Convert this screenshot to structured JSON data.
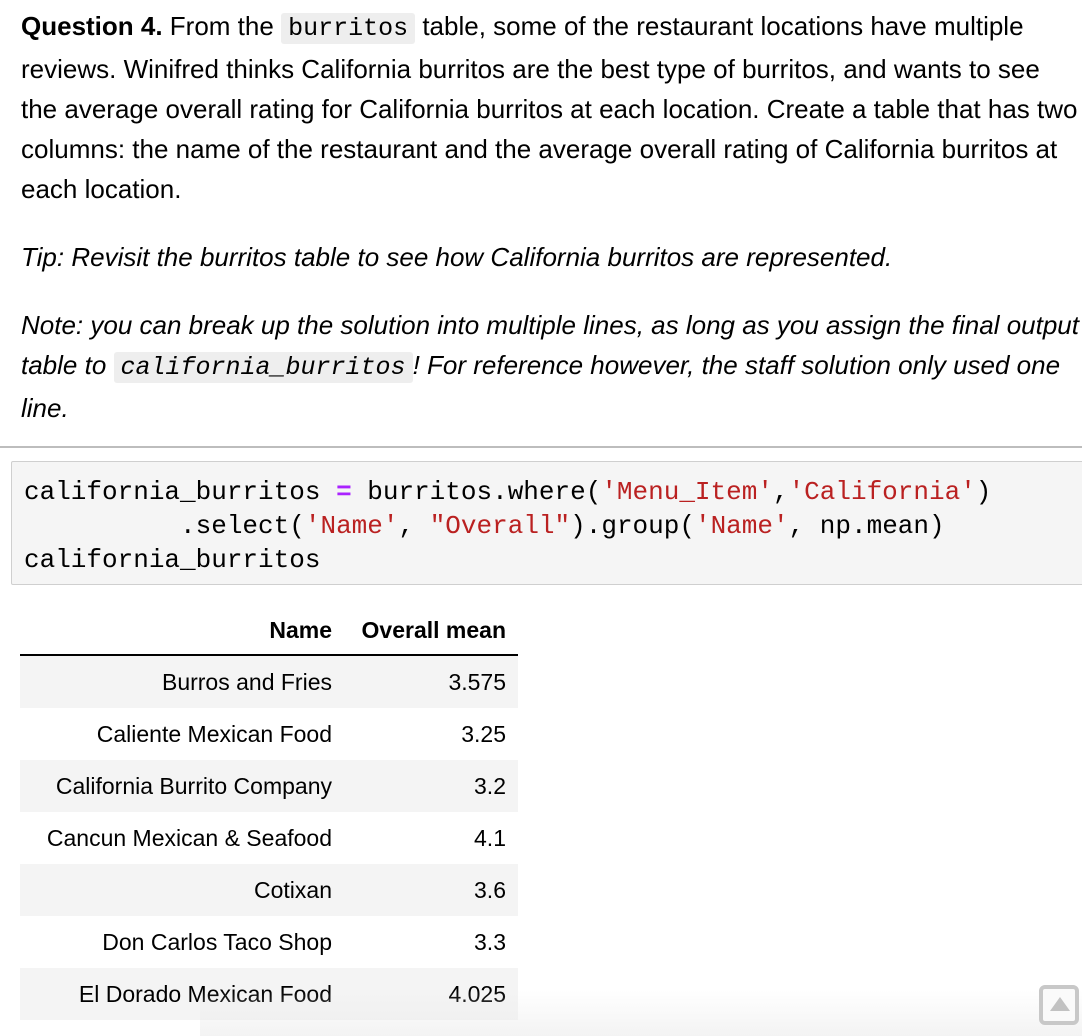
{
  "markdown": {
    "question_label": "Question 4.",
    "q_part1": " From the ",
    "q_code": "burritos",
    "q_part2": " table, some of the restaurant locations have multiple reviews. Winifred thinks California burritos are the best type of burritos, and wants to see the average overall rating for California burritos at each location. Create a table that has two columns: the name of the restaurant and the average overall rating of California burritos at each location.",
    "tip": "Tip: Revisit the burritos table to see how California burritos are represented.",
    "note_part1": "Note: you can break up the solution into multiple lines, as long as you assign the final output table to ",
    "note_code": "california_burritos",
    "note_part2": "! For reference however, the staff solution only used one line."
  },
  "code_cell": {
    "l1_a": "california_burritos ",
    "l1_op": "=",
    "l1_b": " burritos.where(",
    "l1_s1": "'Menu_Item'",
    "l1_c": ",",
    "l1_s2": "'California'",
    "l1_d": ")",
    "l2_a": "          .select(",
    "l2_s1": "'Name'",
    "l2_b": ", ",
    "l2_s2": "\"Overall\"",
    "l2_c": ").group(",
    "l2_s3": "'Name'",
    "l2_d": ", np.mean)",
    "l3": "california_burritos"
  },
  "output_table": {
    "headers": [
      "Name",
      "Overall mean"
    ],
    "rows": [
      [
        "Burros and Fries",
        "3.575"
      ],
      [
        "Caliente Mexican Food",
        "3.25"
      ],
      [
        "California Burrito Company",
        "3.2"
      ],
      [
        "Cancun Mexican & Seafood",
        "4.1"
      ],
      [
        "Cotixan",
        "3.6"
      ],
      [
        "Don Carlos Taco Shop",
        "3.3"
      ],
      [
        "El Dorado Mexican Food",
        "4.025"
      ]
    ]
  },
  "scroll_button": {
    "icon": "triangle-up-icon"
  }
}
